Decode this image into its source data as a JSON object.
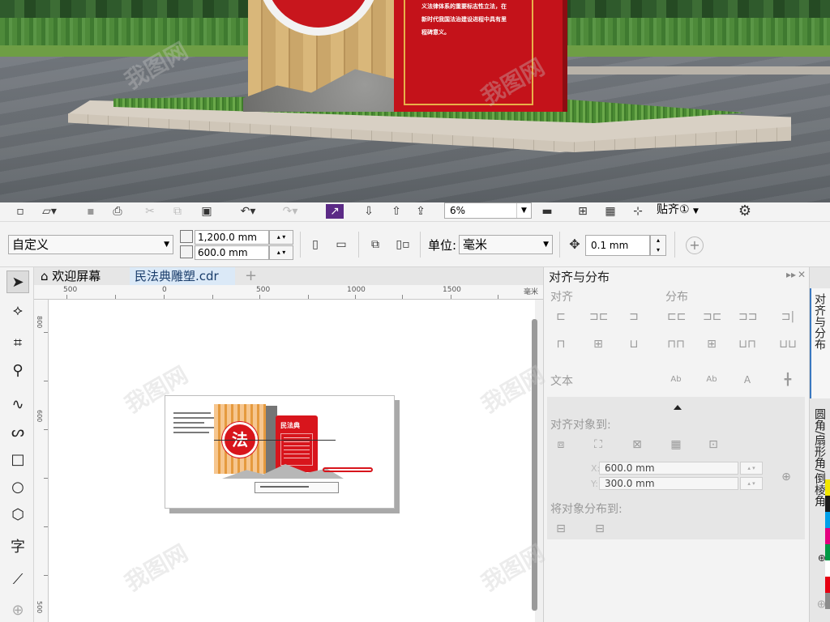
{
  "render": {
    "board_text": [
      "义法律体系的重要标志性立法，在",
      "新时代我国法治建设进程中具有里",
      "程碑意义。"
    ]
  },
  "toolbar": {
    "zoom": "6%",
    "snap_label": "贴齐",
    "snap_shortcut": "①"
  },
  "property_bar": {
    "page_preset": "自定义",
    "width": "1,200.0 mm",
    "height": "600.0 mm",
    "units_label": "单位:",
    "units_value": "毫米",
    "nudge": "0.1 mm"
  },
  "tabs": {
    "home": "欢迎屏幕",
    "document": "民法典雕塑.cdr",
    "add": "+"
  },
  "ruler": {
    "h_labels": [
      "500",
      "0",
      "500",
      "1000",
      "1500"
    ],
    "unit": "毫米",
    "v_labels": [
      "800",
      "600",
      "500"
    ]
  },
  "design": {
    "circle_char": "法",
    "book_title": "民法典"
  },
  "docker": {
    "title": "对齐与分布",
    "align_header": "对齐",
    "distribute_header": "分布",
    "text_header": "文本",
    "align_to_header": "对齐对象到:",
    "x_label": "X:",
    "x_value": "600.0 mm",
    "y_label": "Y:",
    "y_value": "300.0 mm",
    "distribute_to_header": "将对象分布到:"
  },
  "side_tabs": {
    "tab1": "对齐与分布",
    "tab2": "圆角/扇形角/倒棱角"
  },
  "palette_colors": [
    "#f2e600",
    "#1a1a1a",
    "#00a0e9",
    "#e4007f",
    "#009944",
    "#ffffff",
    "#e60012",
    "#8c8c8c"
  ],
  "watermark": "我图网"
}
